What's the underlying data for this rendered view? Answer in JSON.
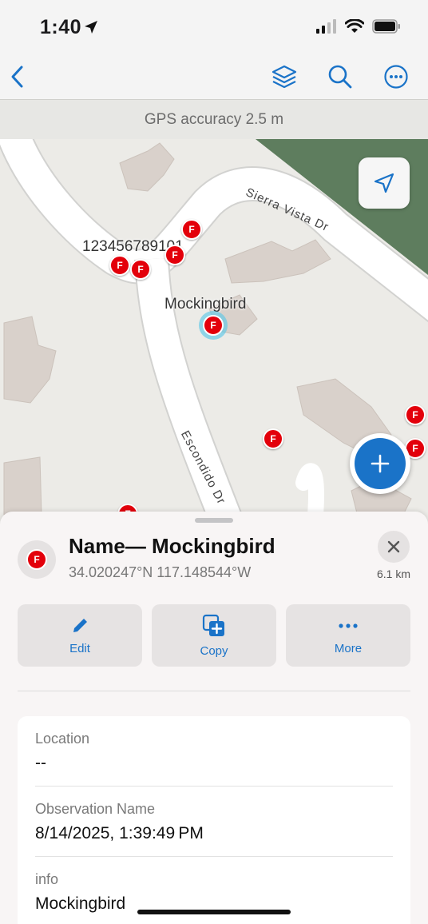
{
  "status_bar": {
    "time": "1:40"
  },
  "banner": {
    "gps_text": "GPS accuracy 2.5 m"
  },
  "map": {
    "streets": [
      "Sierra Vista Dr",
      "Escondido Dr"
    ],
    "labels": {
      "cluster": "123456789101",
      "selected": "Mockingbird"
    },
    "marker_letter": "F"
  },
  "feature": {
    "icon_letter": "F",
    "title": "Name— Mockingbird",
    "coords": "34.020247°N  117.148544°W",
    "distance": "6.1 km"
  },
  "actions": {
    "edit": "Edit",
    "copy": "Copy",
    "more": "More"
  },
  "fields": [
    {
      "label": "Location",
      "value": "--"
    },
    {
      "label": "Observation Name",
      "value": "8/14/2025, 1:39:49 PM"
    },
    {
      "label": "info",
      "value": "Mockingbird"
    }
  ],
  "colors": {
    "accent": "#1a73c8",
    "marker": "#e3000b",
    "park": "#5e7d5e",
    "building": "#d9d1cb",
    "road": "#ffffff"
  },
  "icons": [
    "location-arrow-icon",
    "signal-icon",
    "wifi-icon",
    "battery-icon",
    "back-chevron-icon",
    "layers-icon",
    "search-icon",
    "more-icon",
    "navigate-icon",
    "plus-icon",
    "close-icon",
    "pencil-icon",
    "copy-icon",
    "ellipsis-icon"
  ]
}
